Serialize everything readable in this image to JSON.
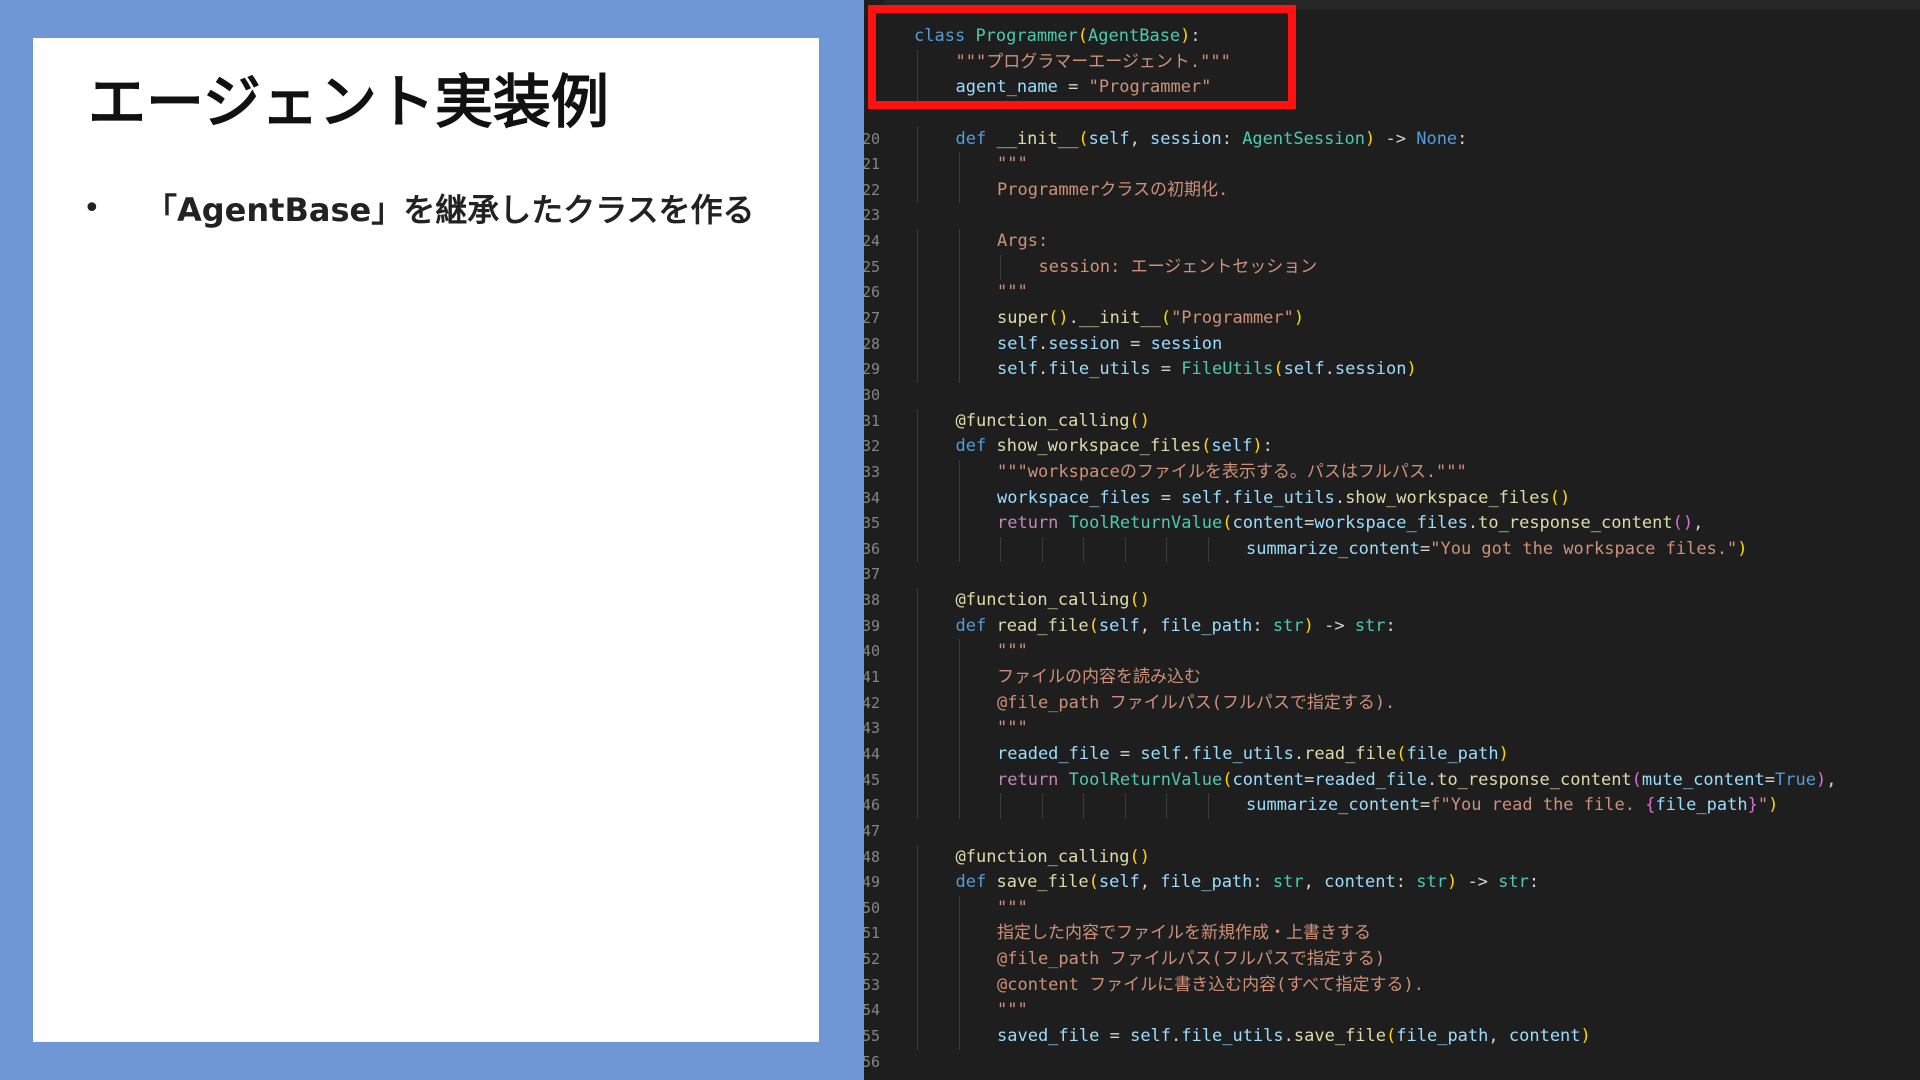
{
  "slide": {
    "title": "エージェント実装例",
    "bullets": [
      "「AgentBase」を継承したクラスを作る"
    ],
    "bullet_marker": "•"
  },
  "colors": {
    "background": "#6f97d6",
    "panel": "#ffffff",
    "editor_bg": "#1e1e1e",
    "highlight": "#ff1111"
  },
  "code": {
    "lines": [
      {
        "no": "",
        "indent": 1,
        "tokens": [
          {
            "t": "class",
            "c": "kw"
          },
          {
            "t": " ",
            "c": "punct"
          },
          {
            "t": "Programmer",
            "c": "cls"
          },
          {
            "t": "(",
            "c": "paren"
          },
          {
            "t": "AgentBase",
            "c": "cls"
          },
          {
            "t": ")",
            "c": "paren"
          },
          {
            "t": ":",
            "c": "punct"
          }
        ]
      },
      {
        "no": "",
        "indent": 2,
        "tokens": [
          {
            "t": "\"\"\"プログラマーエージェント.\"\"\"",
            "c": "str"
          }
        ]
      },
      {
        "no": "",
        "indent": 2,
        "tokens": [
          {
            "t": "agent_name",
            "c": "var"
          },
          {
            "t": " = ",
            "c": "punct"
          },
          {
            "t": "\"Programmer\"",
            "c": "str"
          }
        ]
      },
      {
        "no": "",
        "indent": 0,
        "tokens": []
      },
      {
        "no": "20",
        "indent": 2,
        "tokens": [
          {
            "t": "def",
            "c": "kw"
          },
          {
            "t": " ",
            "c": "punct"
          },
          {
            "t": "__init__",
            "c": "fn"
          },
          {
            "t": "(",
            "c": "paren"
          },
          {
            "t": "self",
            "c": "self"
          },
          {
            "t": ", ",
            "c": "punct"
          },
          {
            "t": "session",
            "c": "var"
          },
          {
            "t": ": ",
            "c": "punct"
          },
          {
            "t": "AgentSession",
            "c": "type"
          },
          {
            "t": ")",
            "c": "paren"
          },
          {
            "t": " -> ",
            "c": "punct"
          },
          {
            "t": "None",
            "c": "bool"
          },
          {
            "t": ":",
            "c": "punct"
          }
        ]
      },
      {
        "no": "21",
        "indent": 3,
        "tokens": [
          {
            "t": "\"\"\"",
            "c": "str"
          }
        ]
      },
      {
        "no": "22",
        "indent": 3,
        "tokens": [
          {
            "t": "Programmerクラスの初期化.",
            "c": "str"
          }
        ]
      },
      {
        "no": "23",
        "indent": 0,
        "tokens": []
      },
      {
        "no": "24",
        "indent": 3,
        "tokens": [
          {
            "t": "Args:",
            "c": "str"
          }
        ]
      },
      {
        "no": "25",
        "indent": 4,
        "tokens": [
          {
            "t": "session: エージェントセッション",
            "c": "str"
          }
        ]
      },
      {
        "no": "26",
        "indent": 3,
        "tokens": [
          {
            "t": "\"\"\"",
            "c": "str"
          }
        ]
      },
      {
        "no": "27",
        "indent": 3,
        "tokens": [
          {
            "t": "super",
            "c": "fn"
          },
          {
            "t": "()",
            "c": "paren"
          },
          {
            "t": ".",
            "c": "punct"
          },
          {
            "t": "__init__",
            "c": "fn"
          },
          {
            "t": "(",
            "c": "paren"
          },
          {
            "t": "\"Programmer\"",
            "c": "str"
          },
          {
            "t": ")",
            "c": "paren"
          }
        ]
      },
      {
        "no": "28",
        "indent": 3,
        "tokens": [
          {
            "t": "self",
            "c": "self"
          },
          {
            "t": ".",
            "c": "punct"
          },
          {
            "t": "session",
            "c": "var"
          },
          {
            "t": " = ",
            "c": "punct"
          },
          {
            "t": "session",
            "c": "var"
          }
        ]
      },
      {
        "no": "29",
        "indent": 3,
        "tokens": [
          {
            "t": "self",
            "c": "self"
          },
          {
            "t": ".",
            "c": "punct"
          },
          {
            "t": "file_utils",
            "c": "var"
          },
          {
            "t": " = ",
            "c": "punct"
          },
          {
            "t": "FileUtils",
            "c": "type"
          },
          {
            "t": "(",
            "c": "paren"
          },
          {
            "t": "self",
            "c": "self"
          },
          {
            "t": ".",
            "c": "punct"
          },
          {
            "t": "session",
            "c": "var"
          },
          {
            "t": ")",
            "c": "paren"
          }
        ]
      },
      {
        "no": "30",
        "indent": 0,
        "tokens": []
      },
      {
        "no": "31",
        "indent": 2,
        "tokens": [
          {
            "t": "@function_calling",
            "c": "deco"
          },
          {
            "t": "()",
            "c": "paren"
          }
        ]
      },
      {
        "no": "32",
        "indent": 2,
        "tokens": [
          {
            "t": "def",
            "c": "kw"
          },
          {
            "t": " ",
            "c": "punct"
          },
          {
            "t": "show_workspace_files",
            "c": "fn"
          },
          {
            "t": "(",
            "c": "paren"
          },
          {
            "t": "self",
            "c": "self"
          },
          {
            "t": ")",
            "c": "paren"
          },
          {
            "t": ":",
            "c": "punct"
          }
        ]
      },
      {
        "no": "33",
        "indent": 3,
        "tokens": [
          {
            "t": "\"\"\"workspaceのファイルを表示する。パスはフルパス.\"\"\"",
            "c": "str"
          }
        ]
      },
      {
        "no": "34",
        "indent": 3,
        "tokens": [
          {
            "t": "workspace_files",
            "c": "var"
          },
          {
            "t": " = ",
            "c": "punct"
          },
          {
            "t": "self",
            "c": "self"
          },
          {
            "t": ".",
            "c": "punct"
          },
          {
            "t": "file_utils",
            "c": "var"
          },
          {
            "t": ".",
            "c": "punct"
          },
          {
            "t": "show_workspace_files",
            "c": "fn"
          },
          {
            "t": "()",
            "c": "paren"
          }
        ]
      },
      {
        "no": "35",
        "indent": 3,
        "tokens": [
          {
            "t": "return",
            "c": "ctrl"
          },
          {
            "t": " ",
            "c": "punct"
          },
          {
            "t": "ToolReturnValue",
            "c": "type"
          },
          {
            "t": "(",
            "c": "paren"
          },
          {
            "t": "content",
            "c": "var"
          },
          {
            "t": "=",
            "c": "punct"
          },
          {
            "t": "workspace_files",
            "c": "var"
          },
          {
            "t": ".",
            "c": "punct"
          },
          {
            "t": "to_response_content",
            "c": "fn"
          },
          {
            "t": "()",
            "c": "brace"
          },
          {
            "t": ",",
            "c": "punct"
          }
        ]
      },
      {
        "no": "36",
        "indent": 9,
        "tokens": [
          {
            "t": "summarize_content",
            "c": "var"
          },
          {
            "t": "=",
            "c": "punct"
          },
          {
            "t": "\"You got the workspace files.\"",
            "c": "str"
          },
          {
            "t": ")",
            "c": "paren"
          }
        ]
      },
      {
        "no": "37",
        "indent": 0,
        "tokens": []
      },
      {
        "no": "38",
        "indent": 2,
        "tokens": [
          {
            "t": "@function_calling",
            "c": "deco"
          },
          {
            "t": "()",
            "c": "paren"
          }
        ]
      },
      {
        "no": "39",
        "indent": 2,
        "tokens": [
          {
            "t": "def",
            "c": "kw"
          },
          {
            "t": " ",
            "c": "punct"
          },
          {
            "t": "read_file",
            "c": "fn"
          },
          {
            "t": "(",
            "c": "paren"
          },
          {
            "t": "self",
            "c": "self"
          },
          {
            "t": ", ",
            "c": "punct"
          },
          {
            "t": "file_path",
            "c": "var"
          },
          {
            "t": ": ",
            "c": "punct"
          },
          {
            "t": "str",
            "c": "type"
          },
          {
            "t": ")",
            "c": "paren"
          },
          {
            "t": " -> ",
            "c": "punct"
          },
          {
            "t": "str",
            "c": "type"
          },
          {
            "t": ":",
            "c": "punct"
          }
        ]
      },
      {
        "no": "40",
        "indent": 3,
        "tokens": [
          {
            "t": "\"\"\"",
            "c": "str"
          }
        ]
      },
      {
        "no": "41",
        "indent": 3,
        "tokens": [
          {
            "t": "ファイルの内容を読み込む",
            "c": "str"
          }
        ]
      },
      {
        "no": "42",
        "indent": 3,
        "tokens": [
          {
            "t": "@file_path ファイルパス(フルパスで指定する).",
            "c": "str"
          }
        ]
      },
      {
        "no": "43",
        "indent": 3,
        "tokens": [
          {
            "t": "\"\"\"",
            "c": "str"
          }
        ]
      },
      {
        "no": "44",
        "indent": 3,
        "tokens": [
          {
            "t": "readed_file",
            "c": "var"
          },
          {
            "t": " = ",
            "c": "punct"
          },
          {
            "t": "self",
            "c": "self"
          },
          {
            "t": ".",
            "c": "punct"
          },
          {
            "t": "file_utils",
            "c": "var"
          },
          {
            "t": ".",
            "c": "punct"
          },
          {
            "t": "read_file",
            "c": "fn"
          },
          {
            "t": "(",
            "c": "paren"
          },
          {
            "t": "file_path",
            "c": "var"
          },
          {
            "t": ")",
            "c": "paren"
          }
        ]
      },
      {
        "no": "45",
        "indent": 3,
        "tokens": [
          {
            "t": "return",
            "c": "ctrl"
          },
          {
            "t": " ",
            "c": "punct"
          },
          {
            "t": "ToolReturnValue",
            "c": "type"
          },
          {
            "t": "(",
            "c": "paren"
          },
          {
            "t": "content",
            "c": "var"
          },
          {
            "t": "=",
            "c": "punct"
          },
          {
            "t": "readed_file",
            "c": "var"
          },
          {
            "t": ".",
            "c": "punct"
          },
          {
            "t": "to_response_content",
            "c": "fn"
          },
          {
            "t": "(",
            "c": "brace"
          },
          {
            "t": "mute_content",
            "c": "var"
          },
          {
            "t": "=",
            "c": "punct"
          },
          {
            "t": "True",
            "c": "bool"
          },
          {
            "t": ")",
            "c": "brace"
          },
          {
            "t": ",",
            "c": "punct"
          }
        ]
      },
      {
        "no": "46",
        "indent": 9,
        "tokens": [
          {
            "t": "summarize_content",
            "c": "var"
          },
          {
            "t": "=",
            "c": "punct"
          },
          {
            "t": "f\"You read the file. ",
            "c": "str"
          },
          {
            "t": "{",
            "c": "brace"
          },
          {
            "t": "file_path",
            "c": "var"
          },
          {
            "t": "}",
            "c": "brace"
          },
          {
            "t": "\"",
            "c": "str"
          },
          {
            "t": ")",
            "c": "paren"
          }
        ]
      },
      {
        "no": "47",
        "indent": 0,
        "tokens": []
      },
      {
        "no": "48",
        "indent": 2,
        "tokens": [
          {
            "t": "@function_calling",
            "c": "deco"
          },
          {
            "t": "()",
            "c": "paren"
          }
        ]
      },
      {
        "no": "49",
        "indent": 2,
        "tokens": [
          {
            "t": "def",
            "c": "kw"
          },
          {
            "t": " ",
            "c": "punct"
          },
          {
            "t": "save_file",
            "c": "fn"
          },
          {
            "t": "(",
            "c": "paren"
          },
          {
            "t": "self",
            "c": "self"
          },
          {
            "t": ", ",
            "c": "punct"
          },
          {
            "t": "file_path",
            "c": "var"
          },
          {
            "t": ": ",
            "c": "punct"
          },
          {
            "t": "str",
            "c": "type"
          },
          {
            "t": ", ",
            "c": "punct"
          },
          {
            "t": "content",
            "c": "var"
          },
          {
            "t": ": ",
            "c": "punct"
          },
          {
            "t": "str",
            "c": "type"
          },
          {
            "t": ")",
            "c": "paren"
          },
          {
            "t": " -> ",
            "c": "punct"
          },
          {
            "t": "str",
            "c": "type"
          },
          {
            "t": ":",
            "c": "punct"
          }
        ]
      },
      {
        "no": "50",
        "indent": 3,
        "tokens": [
          {
            "t": "\"\"\"",
            "c": "str"
          }
        ]
      },
      {
        "no": "51",
        "indent": 3,
        "tokens": [
          {
            "t": "指定した内容でファイルを新規作成・上書きする",
            "c": "str"
          }
        ]
      },
      {
        "no": "52",
        "indent": 3,
        "tokens": [
          {
            "t": "@file_path ファイルパス(フルパスで指定する)",
            "c": "str"
          }
        ]
      },
      {
        "no": "53",
        "indent": 3,
        "tokens": [
          {
            "t": "@content ファイルに書き込む内容(すべて指定する).",
            "c": "str"
          }
        ]
      },
      {
        "no": "54",
        "indent": 3,
        "tokens": [
          {
            "t": "\"\"\"",
            "c": "str"
          }
        ]
      },
      {
        "no": "55",
        "indent": 3,
        "tokens": [
          {
            "t": "saved_file",
            "c": "var"
          },
          {
            "t": " = ",
            "c": "punct"
          },
          {
            "t": "self",
            "c": "self"
          },
          {
            "t": ".",
            "c": "punct"
          },
          {
            "t": "file_utils",
            "c": "var"
          },
          {
            "t": ".",
            "c": "punct"
          },
          {
            "t": "save_file",
            "c": "fn"
          },
          {
            "t": "(",
            "c": "paren"
          },
          {
            "t": "file_path",
            "c": "var"
          },
          {
            "t": ", ",
            "c": "punct"
          },
          {
            "t": "content",
            "c": "var"
          },
          {
            "t": ")",
            "c": "paren"
          }
        ]
      },
      {
        "no": "56",
        "indent": 0,
        "tokens": []
      }
    ]
  }
}
